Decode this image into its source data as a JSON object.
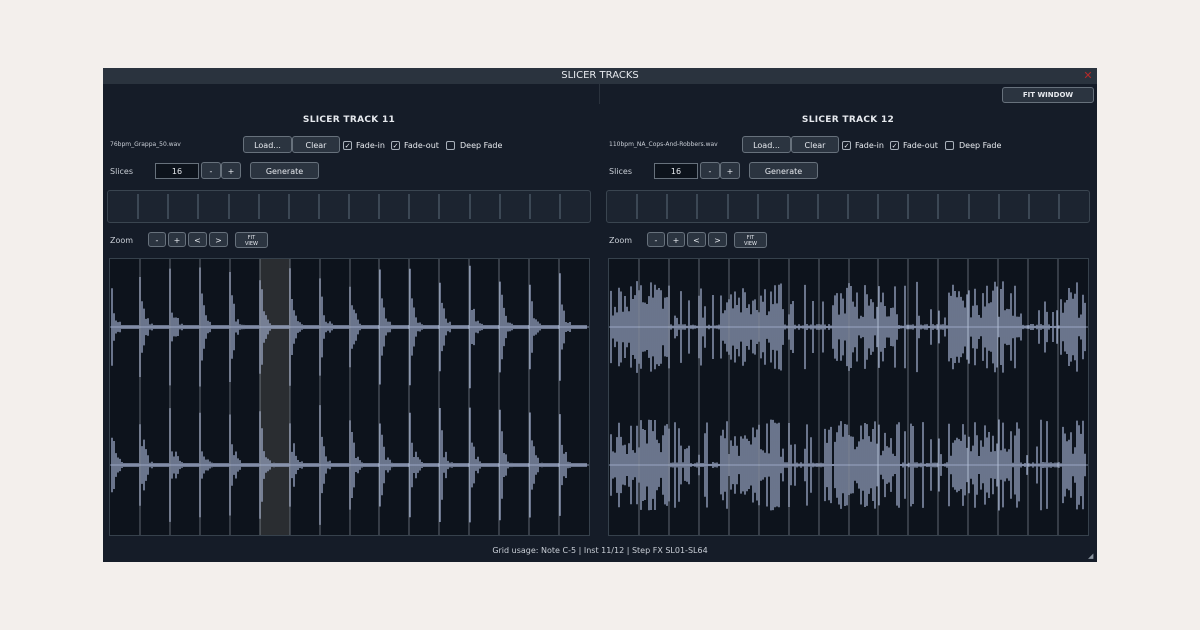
{
  "window": {
    "title": "SLICER TRACKS",
    "close_glyph": "✕",
    "fit_window_label": "FIT WINDOW",
    "status_text": "Grid usage: Note C-5 | Inst 11/12 | Step FX SL01-SL64"
  },
  "colors": {
    "background": "#f3efec",
    "window_bg": "#151c28",
    "waveform": "#a9b6d6",
    "selected_slice": "#2a2d31",
    "slice_line": "#5d6b7a",
    "close": "#b42a2a"
  },
  "panels": [
    {
      "title": "SLICER TRACK 11",
      "filename": "76bpm_Grappa_50.wav",
      "load_label": "Load...",
      "clear_label": "Clear",
      "fade_in_label": "Fade-in",
      "fade_in_checked": true,
      "fade_out_label": "Fade-out",
      "fade_out_checked": true,
      "deep_fade_label": "Deep Fade",
      "deep_fade_checked": false,
      "slices_label": "Slices",
      "slices_value": "16",
      "minus_label": "-",
      "plus_label": "+",
      "generate_label": "Generate",
      "zoom_label": "Zoom",
      "zoom_out_label": "-",
      "zoom_in_label": "+",
      "scroll_left_label": "<",
      "scroll_right_label": ">",
      "fit_view_line1": "FIT",
      "fit_view_line2": "VIEW",
      "slice_count": 16,
      "selected_slice": 5
    },
    {
      "title": "SLICER TRACK 12",
      "filename": "110bpm_NA_Cops-And-Robbers.wav",
      "load_label": "Load...",
      "clear_label": "Clear",
      "fade_in_label": "Fade-in",
      "fade_in_checked": true,
      "fade_out_label": "Fade-out",
      "fade_out_checked": true,
      "deep_fade_label": "Deep Fade",
      "deep_fade_checked": false,
      "slices_label": "Slices",
      "slices_value": "16",
      "minus_label": "-",
      "plus_label": "+",
      "generate_label": "Generate",
      "zoom_label": "Zoom",
      "zoom_out_label": "-",
      "zoom_in_label": "+",
      "scroll_left_label": "<",
      "scroll_right_label": ">",
      "fit_view_line1": "FIT",
      "fit_view_line2": "VIEW",
      "slice_count": 16,
      "selected_slice": null
    }
  ]
}
